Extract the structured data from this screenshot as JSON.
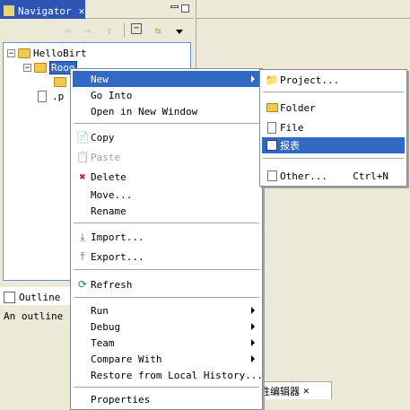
{
  "navigator": {
    "title": "Navigator",
    "tree": {
      "root": "HelloBirt",
      "child_folder": "Rooo",
      "child_file": ".p"
    }
  },
  "outline": {
    "title": "Outline",
    "message": "An outline i"
  },
  "editor_tab": {
    "label": "性编辑器"
  },
  "context_menu": {
    "items": [
      {
        "label": "New",
        "icon": "none",
        "submenu": true,
        "selected": true
      },
      {
        "label": "Go Into",
        "icon": "none"
      },
      {
        "label": "Open in New Window",
        "icon": "none"
      },
      {
        "label": "Copy",
        "icon": "copy-icon"
      },
      {
        "label": "Paste",
        "icon": "paste-icon",
        "disabled": true
      },
      {
        "label": "Delete",
        "icon": "delete-icon"
      },
      {
        "label": "Move...",
        "icon": "none"
      },
      {
        "label": "Rename",
        "icon": "none"
      },
      {
        "label": "Import...",
        "icon": "import-icon"
      },
      {
        "label": "Export...",
        "icon": "export-icon"
      },
      {
        "label": "Refresh",
        "icon": "refresh-icon"
      },
      {
        "label": "Run",
        "submenu": true
      },
      {
        "label": "Debug",
        "submenu": true
      },
      {
        "label": "Team",
        "submenu": true
      },
      {
        "label": "Compare With",
        "submenu": true
      },
      {
        "label": "Restore from Local History..."
      },
      {
        "label": "Properties"
      }
    ]
  },
  "new_submenu": {
    "items": [
      {
        "label": "Project...",
        "icon": "project-icon"
      },
      {
        "label": "Folder",
        "icon": "folder-icon"
      },
      {
        "label": "File",
        "icon": "file-icon"
      },
      {
        "label": "报表",
        "icon": "report-icon",
        "selected": true
      },
      {
        "label": "Other...",
        "icon": "other-icon",
        "accelerator": "Ctrl+N"
      }
    ]
  },
  "colors": {
    "selection": "#316ac5",
    "active_tab": "#2f55b4",
    "background": "#ece9d8"
  }
}
